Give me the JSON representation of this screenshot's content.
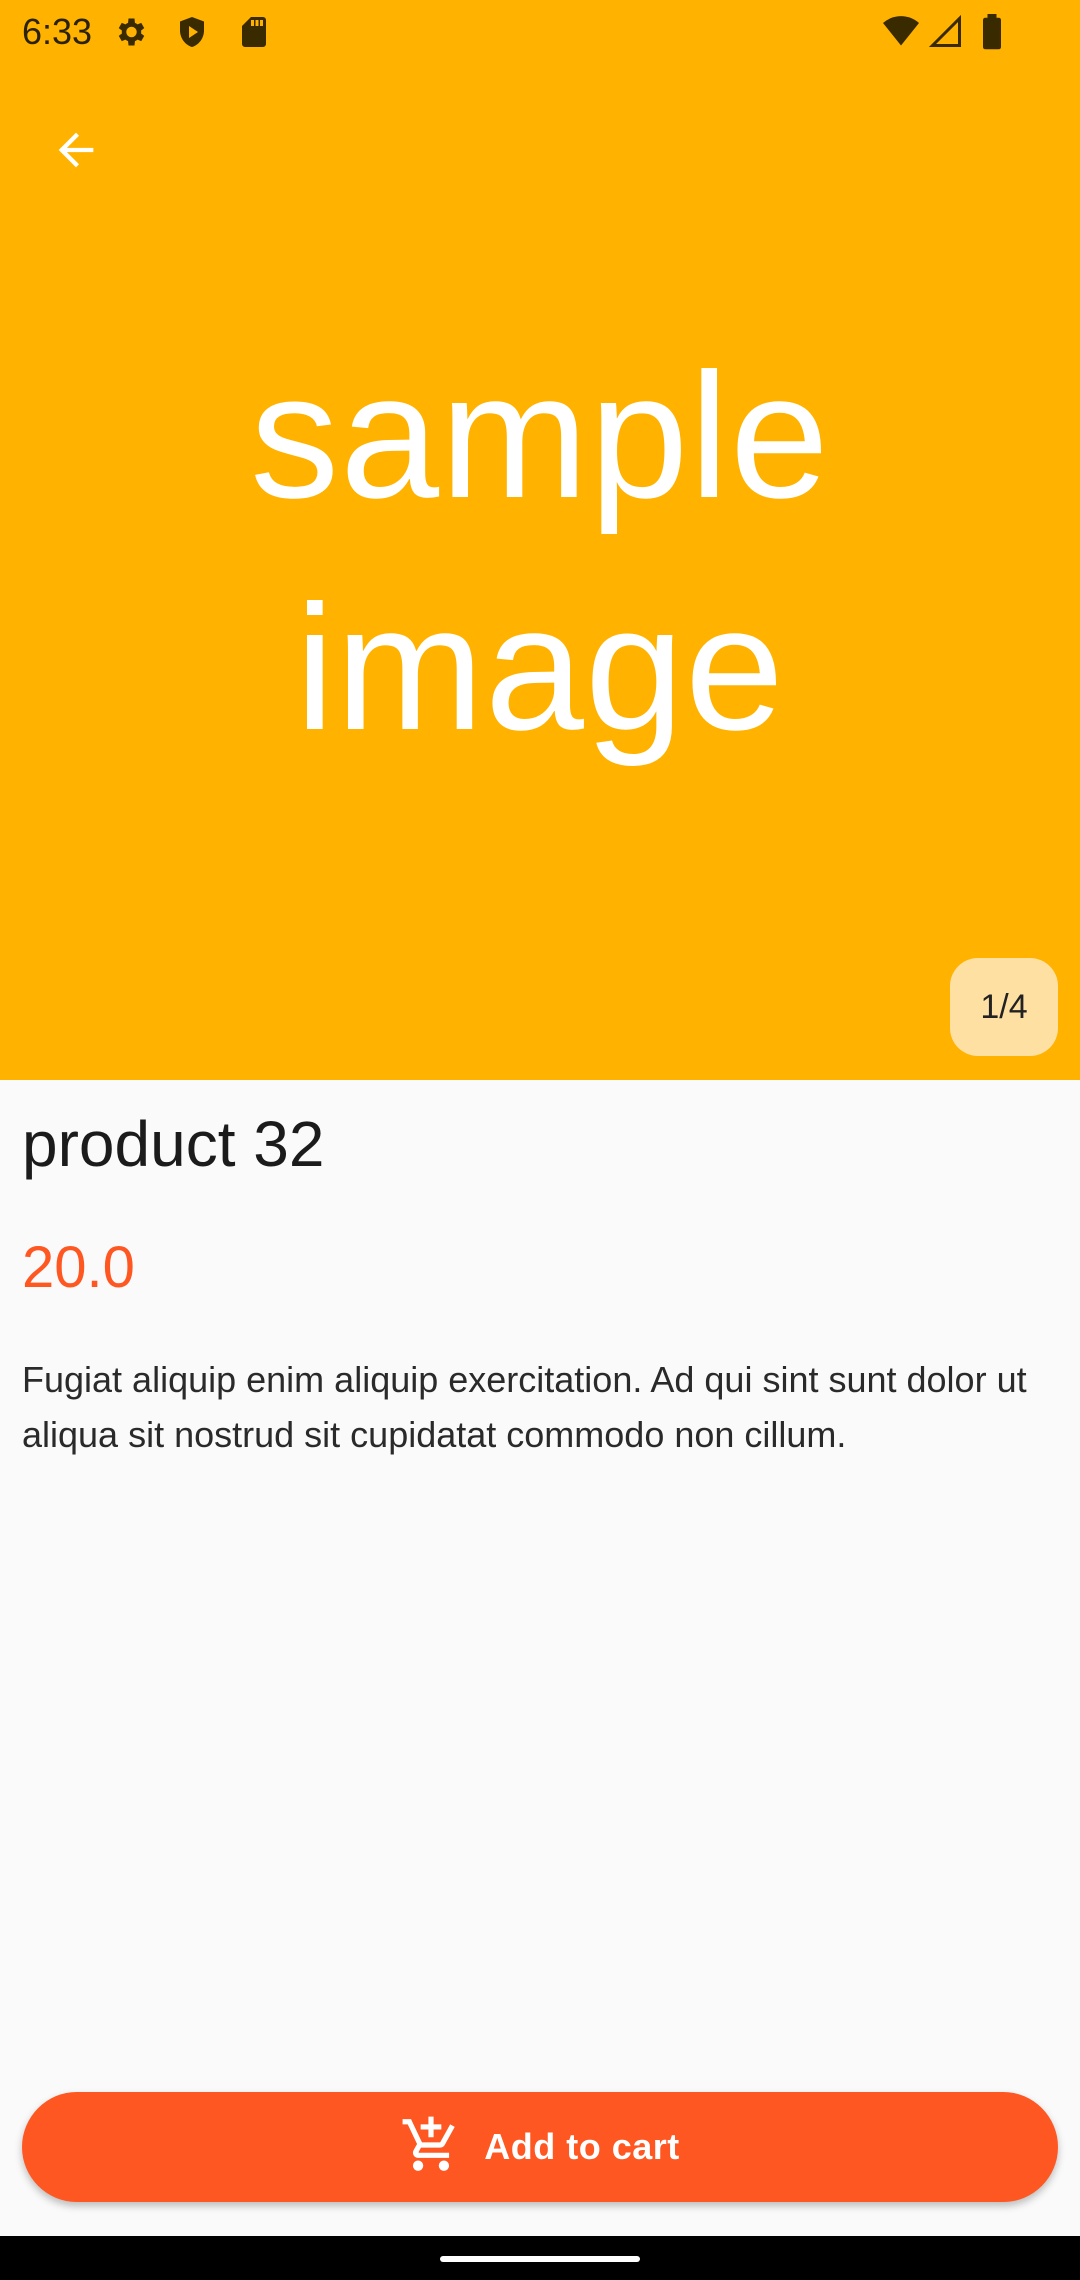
{
  "status_bar": {
    "time": "6:33",
    "left_icons": [
      "settings-icon",
      "shield-play-icon",
      "sd-card-icon"
    ],
    "right_icons": [
      "wifi-icon",
      "signal-icon",
      "battery-icon"
    ]
  },
  "app_bar": {
    "back_icon": "arrow-back-icon"
  },
  "hero": {
    "background": "#ffb300",
    "image_text_line1": "sample",
    "image_text_line2": "image",
    "page_indicator": "1/4"
  },
  "product": {
    "title": "product 32",
    "price": "20.0",
    "price_color": "#ff5722",
    "description": "Fugiat aliquip enim aliquip exercitation. Ad qui sint sunt dolor ut aliqua sit nostrud sit cupidatat commodo non cillum."
  },
  "actions": {
    "add_to_cart_label": "Add to cart",
    "add_to_cart_icon": "add-shopping-cart-icon",
    "button_color": "#ff5722"
  }
}
